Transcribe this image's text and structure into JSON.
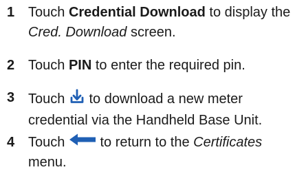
{
  "steps": [
    {
      "number": "1",
      "prefix": "Touch ",
      "bold": "Credential Download",
      "middle": " to display the ",
      "italic": "Cred. Download",
      "suffix": " screen."
    },
    {
      "number": "2",
      "prefix": "Touch ",
      "bold": "PIN",
      "suffix": " to enter the required pin."
    },
    {
      "number": "3",
      "prefix": "Touch ",
      "icon": "download-icon",
      "suffix": " to download a new meter credential via the Handheld Base Unit."
    },
    {
      "number": "4",
      "prefix": "Touch ",
      "icon": "back-arrow-icon",
      "middle": " to return to the ",
      "italic": "Certificates",
      "suffix": " menu."
    }
  ],
  "colors": {
    "text": "#1a1a1a",
    "icon": "#1f5fb4"
  }
}
